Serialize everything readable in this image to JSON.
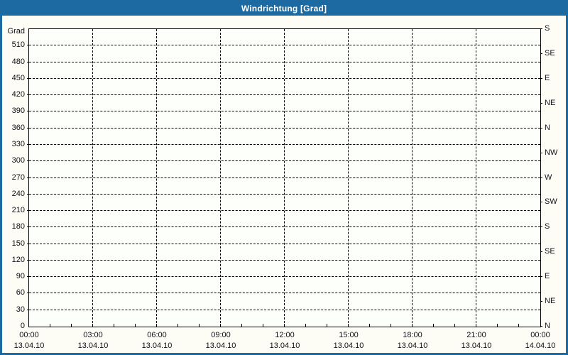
{
  "window": {
    "title": "Windrichtung [Grad]"
  },
  "colors": {
    "chrome_blue": "#1d6aa2",
    "page_background": "#fdfdf6",
    "plot_background": "#fdfffa",
    "grid_color": "#000000",
    "label_color": "#101018",
    "title_text": "#ffffff"
  },
  "chart_data": {
    "type": "line",
    "title": "Windrichtung [Grad]",
    "series": [],
    "grid": {
      "style": "dashed",
      "horizontal_step_deg": 30,
      "vertical_step_hours": 3
    },
    "y_axis_left": {
      "label": "Grad",
      "min": 0,
      "max": 540,
      "tick_step": 30,
      "tick_labels": [
        "0",
        "30",
        "60",
        "90",
        "120",
        "150",
        "180",
        "210",
        "240",
        "270",
        "300",
        "330",
        "360",
        "390",
        "420",
        "450",
        "480",
        "510"
      ]
    },
    "y_axis_right": {
      "unit": "compass",
      "tick_step_deg": 45,
      "labels_bottom_to_top": [
        "N",
        "NE",
        "E",
        "SE",
        "S",
        "SW",
        "W",
        "NW",
        "N",
        "NE",
        "E",
        "SE",
        "S"
      ]
    },
    "x_axis": {
      "major_tick_hours": 3,
      "minor_tick_hours": 1,
      "total_hours": 24,
      "ticks": [
        {
          "time": "00:00",
          "date": "13.04.10"
        },
        {
          "time": "03:00",
          "date": "13.04.10"
        },
        {
          "time": "06:00",
          "date": "13.04.10"
        },
        {
          "time": "09:00",
          "date": "13.04.10"
        },
        {
          "time": "12:00",
          "date": "13.04.10"
        },
        {
          "time": "15:00",
          "date": "13.04.10"
        },
        {
          "time": "18:00",
          "date": "13.04.10"
        },
        {
          "time": "21:00",
          "date": "13.04.10"
        },
        {
          "time": "00:00",
          "date": "14.04.10"
        }
      ]
    }
  }
}
